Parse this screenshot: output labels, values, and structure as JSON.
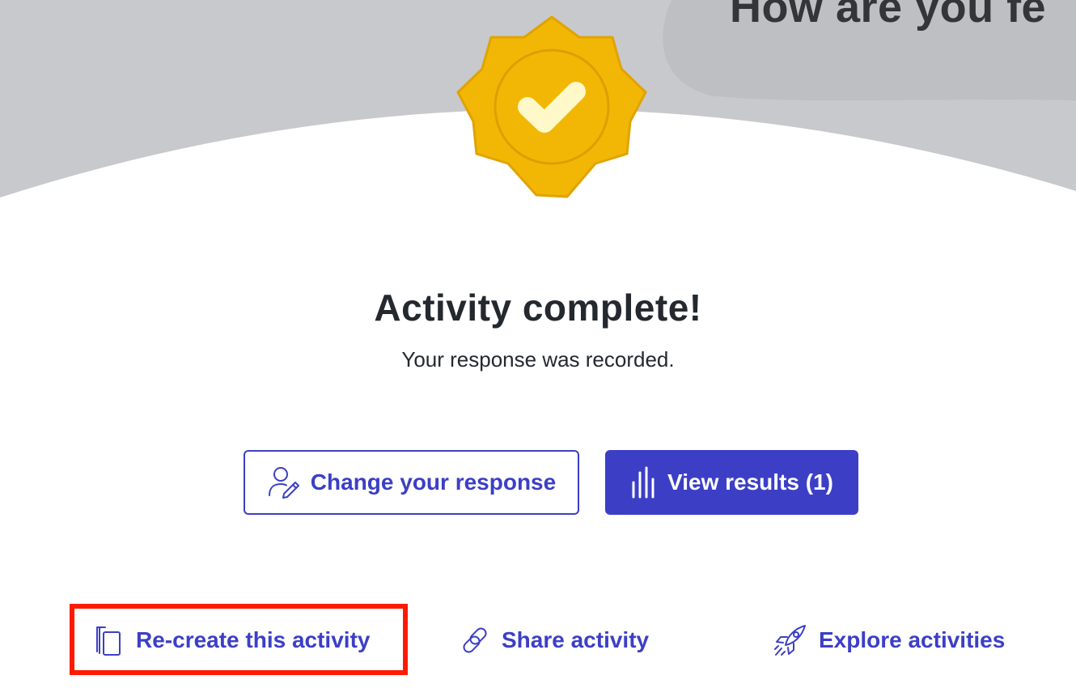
{
  "slide": {
    "title": "How are you fe"
  },
  "completion": {
    "title": "Activity complete!",
    "subtitle": "Your response was recorded."
  },
  "buttons": {
    "change_response": {
      "label": "Change your response",
      "icon": "user-edit-icon"
    },
    "view_results": {
      "label": "View results (1)",
      "icon": "bar-chart-icon"
    }
  },
  "links": {
    "recreate": {
      "label": "Re-create this activity",
      "icon": "copy-icon"
    },
    "share": {
      "label": "Share activity",
      "icon": "link-icon"
    },
    "explore": {
      "label": "Explore activities",
      "icon": "rocket-icon"
    }
  },
  "colors": {
    "accent": "#3c3fc6",
    "badge_gold": "#f2b705",
    "backdrop_gray": "#c7c9cd",
    "highlight": "#ff1a00"
  }
}
